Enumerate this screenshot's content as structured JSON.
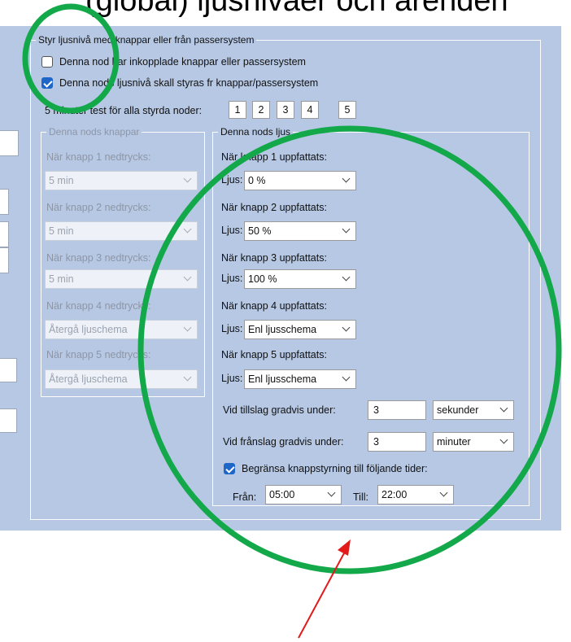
{
  "top_caption": "(global) ljusnivåer och ärenden",
  "group_main": {
    "title": "Styr ljusnivå med knappar eller från passersystem"
  },
  "checkbox1": {
    "label": "Denna nod har inkopplade knappar eller passersystem",
    "checked": false
  },
  "checkbox2": {
    "label": "Denna nods ljusnivå skall styras fr knappar/passersystem",
    "checked": true
  },
  "test": {
    "label": "5 minuter test för alla styrda noder:",
    "buttons": [
      "1",
      "2",
      "3",
      "4",
      "5"
    ]
  },
  "left_group": {
    "title": "Denna nods knappar",
    "items": [
      {
        "label": "När knapp 1 nedtrycks:",
        "value": "5 min"
      },
      {
        "label": "När knapp 2 nedtrycks:",
        "value": "5 min"
      },
      {
        "label": "När knapp 3 nedtrycks:",
        "value": "5 min"
      },
      {
        "label": "När knapp 4 nedtrycks:",
        "value": "Återgå ljuschema"
      },
      {
        "label": "När knapp 5 nedtrycks:",
        "value": "Återgå ljuschema"
      }
    ]
  },
  "right_group": {
    "title": "Denna nods ljus",
    "ljus_label": "Ljus:",
    "items": [
      {
        "label": "När knapp 1 uppfattats:",
        "value": "0 %"
      },
      {
        "label": "När knapp 2 uppfattats:",
        "value": "50 %"
      },
      {
        "label": "När knapp 3 uppfattats:",
        "value": "100 %"
      },
      {
        "label": "När knapp 4 uppfattats:",
        "value": "Enl ljusschema"
      },
      {
        "label": "När knapp 5 uppfattats:",
        "value": "Enl ljusschema"
      }
    ],
    "tillslag": {
      "label": "Vid tillslag gradvis under:",
      "value": "3",
      "unit": "sekunder"
    },
    "franslag": {
      "label": "Vid frånslag gradvis under:",
      "value": "3",
      "unit": "minuter"
    },
    "restrict": {
      "label": "Begränsa knappstyrning till följande tider:",
      "checked": true
    },
    "from": {
      "label": "Från:",
      "value": "05:00"
    },
    "to": {
      "label": "Till:",
      "value": "22:00"
    }
  },
  "annotation_colors": {
    "circle": "#13a84a",
    "arrow": "#e21a1a"
  }
}
